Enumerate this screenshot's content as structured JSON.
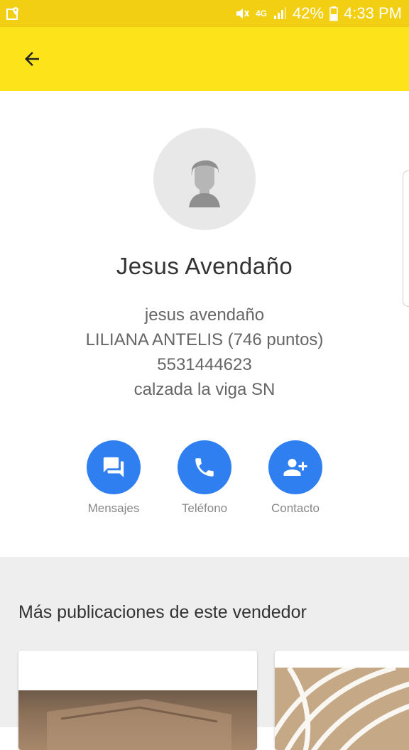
{
  "status_bar": {
    "battery": "42%",
    "time": "4:33 PM",
    "network": "4G",
    "icons": [
      "map-marker-icon",
      "mute-icon",
      "network-4g-icon",
      "signal-icon",
      "battery-icon"
    ]
  },
  "app_bar": {
    "back_icon": "arrow-back-icon",
    "color": "#fde31a"
  },
  "profile": {
    "avatar_icon": "person-placeholder-icon",
    "name": "Jesus Avendaño",
    "username": "jesus avendaño",
    "reputation": "LILIANA ANTELIS (746 puntos)",
    "phone": "5531444623",
    "address": "calzada la viga SN"
  },
  "actions": [
    {
      "label": "Mensajes",
      "icon": "chat-icon"
    },
    {
      "label": "Teléfono",
      "icon": "phone-icon"
    },
    {
      "label": "Contacto",
      "icon": "add-person-icon"
    }
  ],
  "accent_color": "#2f7ff1",
  "more_section": {
    "title": "Más publicaciones de este vendedor"
  }
}
